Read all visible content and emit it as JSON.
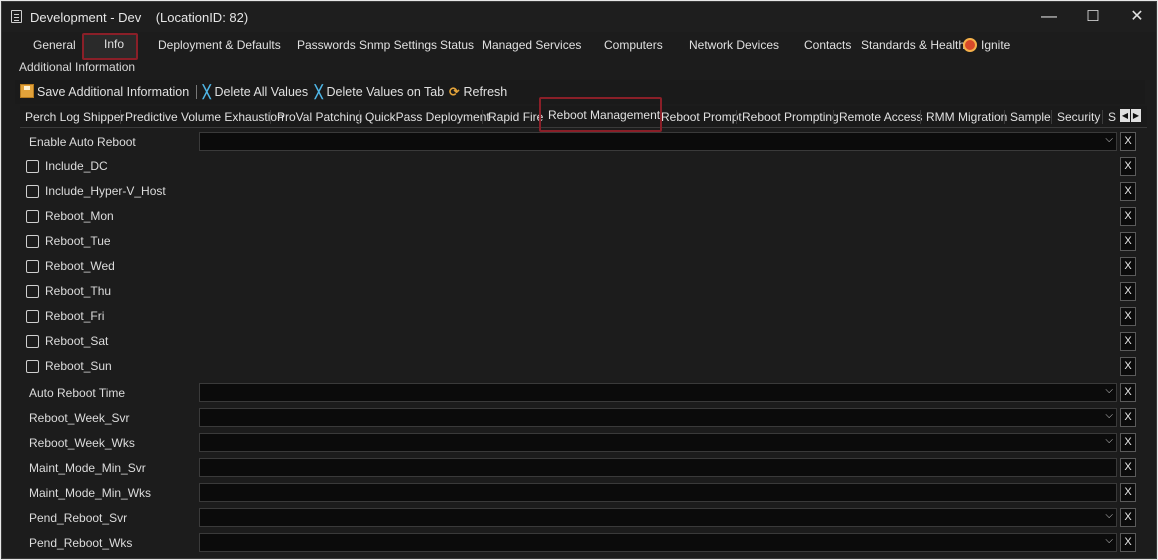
{
  "window": {
    "title": "Development - Dev    (LocationID: 82)",
    "minimize": "—",
    "maximize": "☐",
    "close": "✕"
  },
  "main_tabs": [
    "General",
    "Info",
    "Deployment & Defaults",
    "Passwords",
    "Snmp Settings",
    "Status",
    "Managed Services",
    "Computers",
    "Network Devices",
    "Contacts",
    "Standards & Health",
    "Ignite"
  ],
  "active_main_tab": "Info",
  "section_label": "Additional Information",
  "toolbar": {
    "save": "Save Additional Information",
    "delete_all": "Delete All Values",
    "delete_tab": "Delete Values on Tab",
    "refresh": "Refresh"
  },
  "sub_tabs": [
    "Perch Log Shipper",
    "Predictive Volume Exhaustion",
    "ProVal Patching",
    "QuickPass Deployment",
    "Rapid Fire",
    "Reboot Management",
    "Reboot Prompt",
    "Reboot Prompting",
    "Remote Access",
    "RMM Migration",
    "Sample",
    "Security",
    "S"
  ],
  "active_sub_tab": "Reboot Management",
  "scroll_left": "◀",
  "scroll_right": "▶",
  "clear_label": "X",
  "dropdown_arrow": "⌵",
  "rows": [
    {
      "label": "Enable Auto Reboot",
      "type": "dropdown",
      "value": ""
    },
    {
      "label": "Include_DC",
      "type": "checkbox",
      "checked": false
    },
    {
      "label": "Include_Hyper-V_Host",
      "type": "checkbox",
      "checked": false
    },
    {
      "label": "Reboot_Mon",
      "type": "checkbox",
      "checked": false
    },
    {
      "label": "Reboot_Tue",
      "type": "checkbox",
      "checked": false
    },
    {
      "label": "Reboot_Wed",
      "type": "checkbox",
      "checked": false
    },
    {
      "label": "Reboot_Thu",
      "type": "checkbox",
      "checked": false
    },
    {
      "label": "Reboot_Fri",
      "type": "checkbox",
      "checked": false
    },
    {
      "label": "Reboot_Sat",
      "type": "checkbox",
      "checked": false
    },
    {
      "label": "Reboot_Sun",
      "type": "checkbox",
      "checked": false
    },
    {
      "label": "Auto Reboot Time",
      "type": "dropdown",
      "value": ""
    },
    {
      "label": "Reboot_Week_Svr",
      "type": "dropdown",
      "value": ""
    },
    {
      "label": "Reboot_Week_Wks",
      "type": "dropdown",
      "value": ""
    },
    {
      "label": "Maint_Mode_Min_Svr",
      "type": "text",
      "value": ""
    },
    {
      "label": "Maint_Mode_Min_Wks",
      "type": "text",
      "value": ""
    },
    {
      "label": "Pend_Reboot_Svr",
      "type": "dropdown",
      "value": ""
    },
    {
      "label": "Pend_Reboot_Wks",
      "type": "dropdown",
      "value": ""
    }
  ],
  "colors": {
    "background": "#1c1c1c",
    "highlight": "#8a1f28",
    "field": "#0b0b0b",
    "accent": "#4fb6e6"
  }
}
